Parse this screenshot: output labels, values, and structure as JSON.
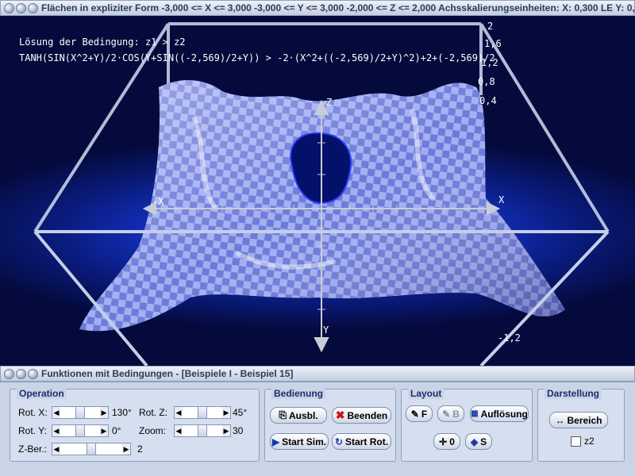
{
  "window": {
    "title": "Flächen in expliziter Form   -3,000 <= X <= 3,000   -3,000 <= Y <= 3,000   -2,000 <= Z <= 2,000   Achsskalierungseinheiten:  X: 0,300 LE    Y: 0,"
  },
  "plot": {
    "condition_label": "Lösung der Bedingung: z1 > z2",
    "formula": "TANH(SIN(X^2+Y)/2·COS(Y+SIN((-2,569)/2+Y)) > -2·(X^2+((-2,569)/2+Y)^2)+2+(-2,569)/2",
    "axis_x_pos": "X",
    "axis_x_neg": "-X",
    "axis_y": "Y",
    "axis_z": "Z",
    "z_scale": [
      "2",
      "1,6",
      "1,2",
      "0,8",
      "0,4"
    ],
    "z_min": "-1,2",
    "colors": {
      "surface": "#8a96e8",
      "background": "#0a1a7a",
      "frame": "#c4cfe8"
    }
  },
  "panel": {
    "title": "Funktionen mit Bedingungen - [Beispiele I - Beispiel 15]",
    "operation": {
      "title": "Operation",
      "rot_x_label": "Rot. X:",
      "rot_x_value": "130°",
      "rot_y_label": "Rot. Y:",
      "rot_y_value": "0°",
      "rot_z_label": "Rot. Z:",
      "rot_z_value": "45°",
      "zoom_label": "Zoom:",
      "zoom_value": "30",
      "zber_label": "Z-Ber.:",
      "zber_value": "2"
    },
    "bedienung": {
      "title": "Bedienung",
      "ausbl": "Ausbl.",
      "beenden": "Beenden",
      "start_sim": "Start Sim.",
      "start_rot": "Start Rot."
    },
    "layout": {
      "title": "Layout",
      "f": "F",
      "b": "B",
      "aufloesung": "Auflösung",
      "o": "0",
      "s": "S"
    },
    "darstellung": {
      "title": "Darstellung",
      "bereich": "Bereich",
      "z2": "z2"
    }
  }
}
